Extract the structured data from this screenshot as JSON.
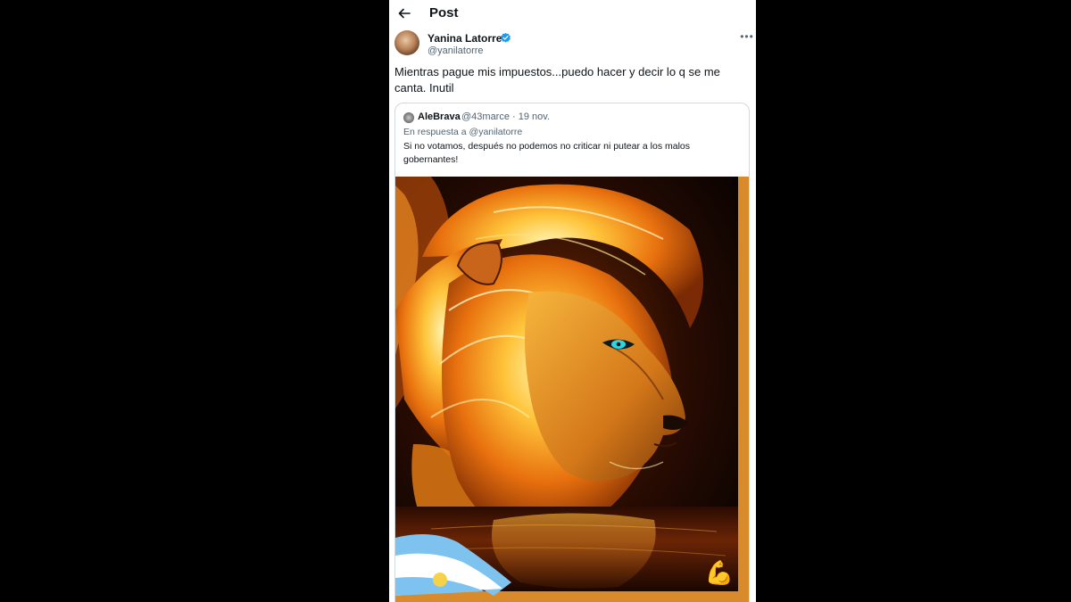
{
  "colors": {
    "page_bg": "#000000",
    "panel_bg": "#ffffff",
    "verified": "#1d9bf0",
    "secondary_text": "#536471"
  },
  "header": {
    "back_icon": "arrow-left-icon",
    "title": "Post"
  },
  "tweet": {
    "author_name": "Yanina Latorre",
    "author_handle": "@yanilatorre",
    "verified_icon": "verified-badge-icon",
    "more_icon": "more-horizontal-icon",
    "more_label": "•••",
    "text": "Mientras pague mis impuestos...puedo hacer y decir lo q se me canta. Inutil"
  },
  "quote": {
    "author_name": "AleBrava",
    "meta": "@43marce · 19 nov.",
    "reply_to": "En respuesta a @yanilatorre",
    "text": "Si no votamos, después no podemos no criticar ni putear a los malos gobernantes!",
    "image_emoji": "💪"
  }
}
